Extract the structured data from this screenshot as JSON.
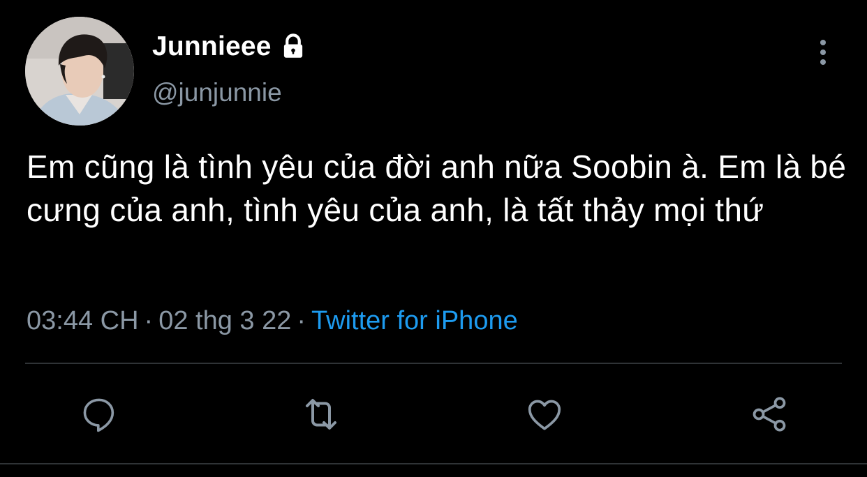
{
  "user": {
    "display_name": "Junnieee",
    "handle": "@junjunnie",
    "avatar_icon": "profile-photo",
    "protected_icon": "lock-icon"
  },
  "tweet": {
    "text": "Em cũng là tình yêu của đời anh nữa Soobin à. Em là bé cưng của anh, tình yêu của anh, là tất thảy mọi thứ",
    "time": "03:44 CH",
    "date": "02 thg 3 22",
    "source": "Twitter for iPhone",
    "separator": "·"
  },
  "actions": [
    {
      "name": "reply",
      "icon": "comment-icon"
    },
    {
      "name": "retweet",
      "icon": "retweet-icon"
    },
    {
      "name": "like",
      "icon": "heart-icon"
    },
    {
      "name": "share",
      "icon": "share-icon"
    }
  ],
  "colors": {
    "background": "#000000",
    "text": "#ffffff",
    "secondary": "#8b98a5",
    "link": "#1d9bf0",
    "divider": "#2f3336"
  }
}
